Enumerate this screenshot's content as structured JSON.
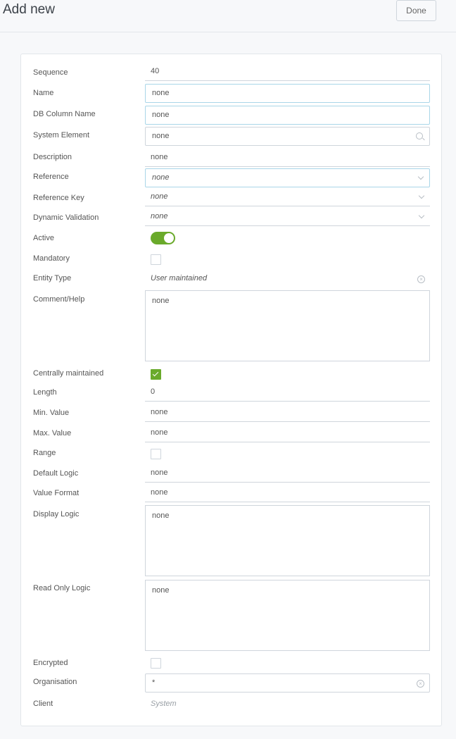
{
  "header": {
    "title": "Add new",
    "done_label": "Done"
  },
  "fields": {
    "sequence": {
      "label": "Sequence",
      "value": "40"
    },
    "name": {
      "label": "Name",
      "value": "none"
    },
    "db_column_name": {
      "label": "DB Column Name",
      "value": "none"
    },
    "system_element": {
      "label": "System Element",
      "value": "none"
    },
    "description": {
      "label": "Description",
      "value": "none"
    },
    "reference": {
      "label": "Reference",
      "value": "none"
    },
    "reference_key": {
      "label": "Reference Key",
      "value": "none"
    },
    "dynamic_validation": {
      "label": "Dynamic Validation",
      "value": "none"
    },
    "active": {
      "label": "Active",
      "checked": true
    },
    "mandatory": {
      "label": "Mandatory",
      "checked": false
    },
    "entity_type": {
      "label": "Entity Type",
      "value": "User maintained"
    },
    "comment_help": {
      "label": "Comment/Help",
      "value": "none"
    },
    "centrally_maintained": {
      "label": "Centrally maintained",
      "checked": true
    },
    "length": {
      "label": "Length",
      "value": "0"
    },
    "min_value": {
      "label": "Min. Value",
      "value": "none"
    },
    "max_value": {
      "label": "Max. Value",
      "value": "none"
    },
    "range": {
      "label": "Range",
      "checked": false
    },
    "default_logic": {
      "label": "Default Logic",
      "value": "none"
    },
    "value_format": {
      "label": "Value Format",
      "value": "none"
    },
    "display_logic": {
      "label": "Display Logic",
      "value": "none"
    },
    "read_only_logic": {
      "label": "Read Only Logic",
      "value": "none"
    },
    "encrypted": {
      "label": "Encrypted",
      "checked": false
    },
    "organisation": {
      "label": "Organisation",
      "value": "*"
    },
    "client": {
      "label": "Client",
      "value": "System"
    }
  },
  "colors": {
    "accent_green": "#6aaa2b",
    "focus_border": "#a9d6e8"
  }
}
